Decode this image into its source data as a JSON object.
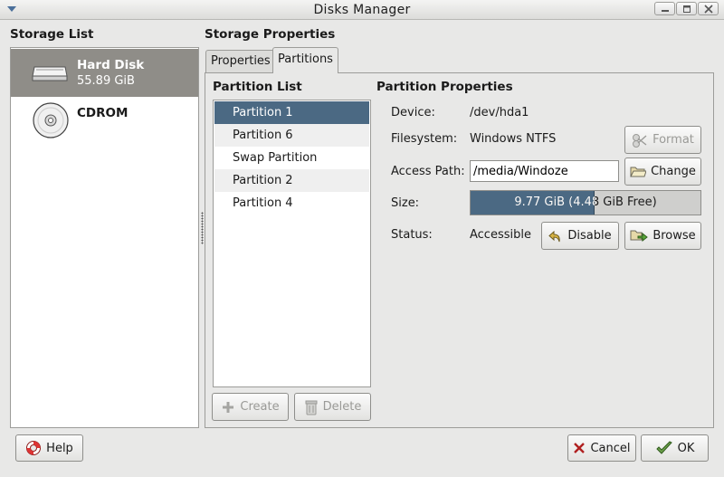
{
  "window": {
    "title": "Disks Manager"
  },
  "storage_list": {
    "title": "Storage List",
    "items": [
      {
        "name": "Hard Disk",
        "size": "55.89 GiB",
        "icon": "hard-disk-icon",
        "selected": true
      },
      {
        "name": "CDROM",
        "size": "",
        "icon": "cdrom-icon",
        "selected": false
      }
    ]
  },
  "storage_properties": {
    "title": "Storage Properties",
    "tabs": [
      {
        "label": "Properties",
        "active": false
      },
      {
        "label": "Partitions",
        "active": true
      }
    ]
  },
  "partition_list": {
    "title": "Partition List",
    "items": [
      "Partition 1",
      "Partition 6",
      "Swap Partition",
      "Partition 2",
      "Partition 4"
    ],
    "selected_index": 0,
    "create_label": "Create",
    "delete_label": "Delete"
  },
  "partition_properties": {
    "title": "Partition Properties",
    "device_label": "Device:",
    "device_value": "/dev/hda1",
    "filesystem_label": "Filesystem:",
    "filesystem_value": "Windows NTFS",
    "format_label": "Format",
    "access_path_label": "Access Path:",
    "access_path_value": "/media/Windoze",
    "change_label": "Change",
    "size_label": "Size:",
    "size_text": "9.77 GiB (4.48 GiB Free)",
    "size_used_fraction": 0.54,
    "status_label": "Status:",
    "status_value": "Accessible",
    "disable_label": "Disable",
    "browse_label": "Browse"
  },
  "footer": {
    "help_label": "Help",
    "cancel_label": "Cancel",
    "ok_label": "OK"
  },
  "colors": {
    "selection": "#4b6983",
    "storage_selection": "#8f8d88",
    "background": "#e8e8e7"
  }
}
